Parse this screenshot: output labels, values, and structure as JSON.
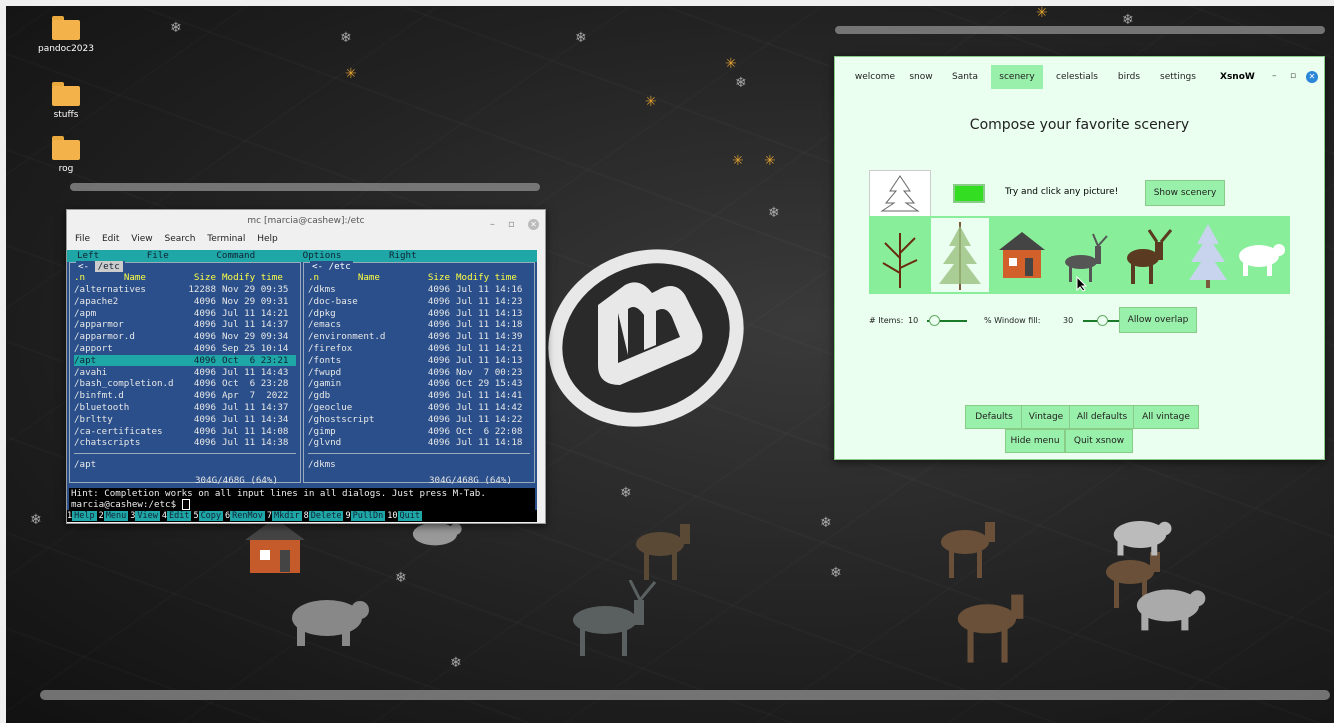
{
  "desktop": {
    "icons": [
      {
        "label": "pandoc2023",
        "icon": "folder-icon"
      },
      {
        "label": "stuffs",
        "icon": "folder-icon"
      },
      {
        "label": "rog",
        "icon": "folder-icon"
      }
    ]
  },
  "terminal": {
    "title": "mc [marcia@cashew]:/etc",
    "menu": [
      "File",
      "Edit",
      "View",
      "Search",
      "Terminal",
      "Help"
    ],
    "mc_menu": [
      "Left",
      "File",
      "Command",
      "Options",
      "Right"
    ],
    "left_panel": {
      "path": "/etc",
      "header": {
        "name": "Name",
        "size": "Size",
        "time": "Modify time",
        "sort": ".n"
      },
      "rows": [
        {
          "name": "/alternatives",
          "size": "12288",
          "time": "Nov 29 09:35"
        },
        {
          "name": "/apache2",
          "size": "4096",
          "time": "Nov 29 09:31"
        },
        {
          "name": "/apm",
          "size": "4096",
          "time": "Jul 11 14:21"
        },
        {
          "name": "/apparmor",
          "size": "4096",
          "time": "Jul 11 14:37"
        },
        {
          "name": "/apparmor.d",
          "size": "4096",
          "time": "Nov 29 09:34"
        },
        {
          "name": "/apport",
          "size": "4096",
          "time": "Sep 25 10:14"
        },
        {
          "name": "/apt",
          "size": "4096",
          "time": "Oct  6 23:21"
        },
        {
          "name": "/avahi",
          "size": "4096",
          "time": "Jul 11 14:43"
        },
        {
          "name": "/bash_completion.d",
          "size": "4096",
          "time": "Oct  6 23:28"
        },
        {
          "name": "/binfmt.d",
          "size": "4096",
          "time": "Apr  7  2022"
        },
        {
          "name": "/bluetooth",
          "size": "4096",
          "time": "Jul 11 14:37"
        },
        {
          "name": "/brltty",
          "size": "4096",
          "time": "Jul 11 14:34"
        },
        {
          "name": "/ca-certificates",
          "size": "4096",
          "time": "Jul 11 14:08"
        },
        {
          "name": "/chatscripts",
          "size": "4096",
          "time": "Jul 11 14:38"
        }
      ],
      "selected_index": 6,
      "footer_path": "/apt",
      "disk": "304G/468G (64%)"
    },
    "right_panel": {
      "path": "/etc",
      "header": {
        "name": "Name",
        "size": "Size",
        "time": "Modify time",
        "sort": ".n"
      },
      "rows": [
        {
          "name": "/dkms",
          "size": "4096",
          "time": "Jul 11 14:16"
        },
        {
          "name": "/doc-base",
          "size": "4096",
          "time": "Jul 11 14:23"
        },
        {
          "name": "/dpkg",
          "size": "4096",
          "time": "Jul 11 14:13"
        },
        {
          "name": "/emacs",
          "size": "4096",
          "time": "Jul 11 14:18"
        },
        {
          "name": "/environment.d",
          "size": "4096",
          "time": "Jul 11 14:39"
        },
        {
          "name": "/firefox",
          "size": "4096",
          "time": "Jul 11 14:21"
        },
        {
          "name": "/fonts",
          "size": "4096",
          "time": "Jul 11 14:13"
        },
        {
          "name": "/fwupd",
          "size": "4096",
          "time": "Nov  7 00:23"
        },
        {
          "name": "/gamin",
          "size": "4096",
          "time": "Oct 29 15:43"
        },
        {
          "name": "/gdb",
          "size": "4096",
          "time": "Jul 11 14:41"
        },
        {
          "name": "/geoclue",
          "size": "4096",
          "time": "Jul 11 14:42"
        },
        {
          "name": "/ghostscript",
          "size": "4096",
          "time": "Jul 11 14:22"
        },
        {
          "name": "/gimp",
          "size": "4096",
          "time": "Oct  6 22:08"
        },
        {
          "name": "/glvnd",
          "size": "4096",
          "time": "Jul 11 14:18"
        }
      ],
      "footer_path": "/dkms",
      "disk": "304G/468G (64%)"
    },
    "hint": "Hint: Completion works on all input lines in all dialogs. Just press M-Tab.",
    "prompt": "marcia@cashew:/etc$",
    "fkeys": [
      {
        "num": "1",
        "label": "Help"
      },
      {
        "num": "2",
        "label": "Menu"
      },
      {
        "num": "3",
        "label": "View"
      },
      {
        "num": "4",
        "label": "Edit"
      },
      {
        "num": "5",
        "label": "Copy"
      },
      {
        "num": "6",
        "label": "RenMov"
      },
      {
        "num": "7",
        "label": "Mkdir"
      },
      {
        "num": "8",
        "label": "Delete"
      },
      {
        "num": "9",
        "label": "PullDn"
      },
      {
        "num": "10",
        "label": "Quit"
      }
    ]
  },
  "xsnow": {
    "tabs": [
      "welcome",
      "snow",
      "Santa",
      "scenery",
      "celestials",
      "birds",
      "settings"
    ],
    "active_tab": "scenery",
    "app_name": "XsnoW",
    "heading": "Compose your favorite scenery",
    "try_text": "Try and click any picture!",
    "show_scenery": "Show scenery",
    "items_label": "# Items:",
    "items_value": "10",
    "fill_label": "% Window fill:",
    "fill_value": "30",
    "allow_overlap": "Allow overlap",
    "buttons_row1": [
      "Defaults",
      "Vintage",
      "All defaults",
      "All vintage"
    ],
    "buttons_row2": [
      "Hide menu",
      "Quit xsnow"
    ],
    "pictures": [
      "bare-tree-icon",
      "pine-tree-icon",
      "house-icon",
      "reindeer-icon",
      "moose-icon",
      "snowy-tree-icon",
      "polar-bear-icon"
    ]
  }
}
